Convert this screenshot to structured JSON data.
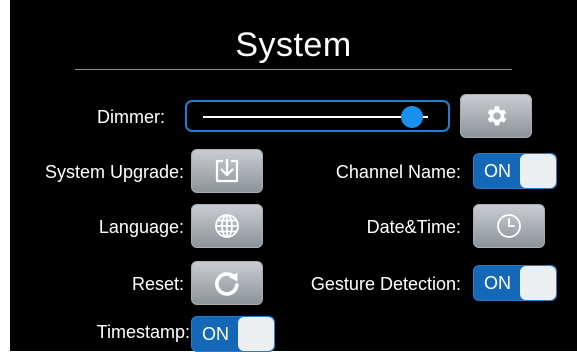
{
  "title": "System",
  "dimmer": {
    "label": "Dimmer:",
    "level": 0.93
  },
  "system_upgrade": {
    "label": "System Upgrade:"
  },
  "language": {
    "label": "Language:"
  },
  "reset": {
    "label": "Reset:"
  },
  "timestamp": {
    "label": "Timestamp:",
    "value": "ON"
  },
  "channel_name": {
    "label": "Channel Name:",
    "value": "ON"
  },
  "date_time": {
    "label": "Date&Time:"
  },
  "gesture_detection": {
    "label": "Gesture Detection:",
    "value": "ON"
  },
  "icons": {
    "dimmer_settings": "gear-icon",
    "system_upgrade": "download-icon",
    "language": "globe-icon",
    "date_time": "clock-icon",
    "reset": "refresh-icon"
  },
  "colors": {
    "background": "#000000",
    "accent": "#1a90ee",
    "toggle_on": "#1568b8",
    "button": "#a9adb2",
    "text": "#ffffff"
  }
}
